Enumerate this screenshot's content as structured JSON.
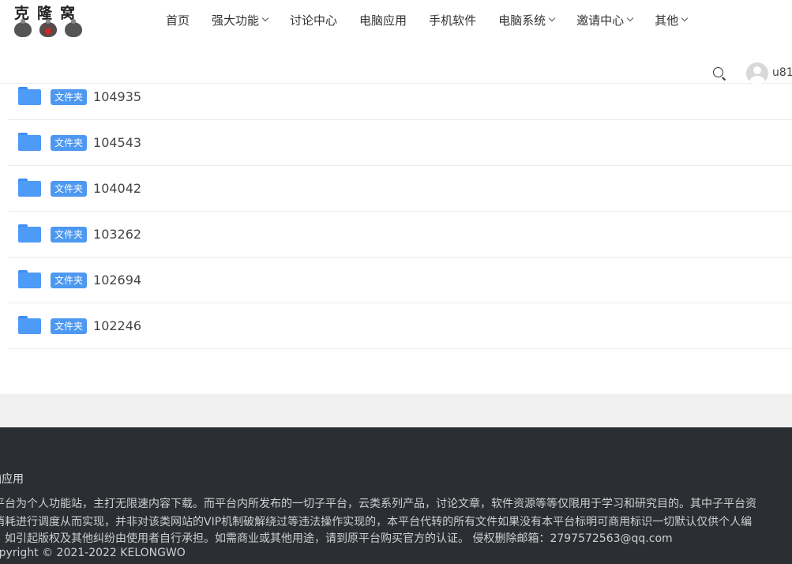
{
  "header": {
    "logo_text": "克隆窝",
    "nav": [
      {
        "label": "首页",
        "has_dropdown": false
      },
      {
        "label": "强大功能",
        "has_dropdown": true
      },
      {
        "label": "讨论中心",
        "has_dropdown": false
      },
      {
        "label": "电脑应用",
        "has_dropdown": false
      },
      {
        "label": "手机软件",
        "has_dropdown": false
      },
      {
        "label": "电脑系统",
        "has_dropdown": true
      },
      {
        "label": "邀请中心",
        "has_dropdown": true
      },
      {
        "label": "其他",
        "has_dropdown": true
      }
    ],
    "username": "u81"
  },
  "files": [
    {
      "badge": "文件夹",
      "name": "104935"
    },
    {
      "badge": "文件夹",
      "name": "104543"
    },
    {
      "badge": "文件夹",
      "name": "104042"
    },
    {
      "badge": "文件夹",
      "name": "103262"
    },
    {
      "badge": "文件夹",
      "name": "102694"
    },
    {
      "badge": "文件夹",
      "name": "102246"
    }
  ],
  "footer": {
    "title": "脑应用",
    "lines": [
      "平台为个人功能站，主打无限速内容下载。而平台内所发布的一切子平台，云类系列产品，讨论文章，软件资源等等仅限用于学习和研究目的。其中子平台资",
      "消耗进行调度从而实现，并非对该类网站的VIP机制破解绕过等违法操作实现的，本平台代转的所有文件如果没有本平台标明可商用标识一切默认仅供个人编",
      "如引起版权及其他纠纷由使用者自行承担。如需商业或其他用途，请到原平台购买官方的认证。 侵权删除邮箱：2797572563@qq.com"
    ],
    "copyright": "opyright © 2021-2022 KELONGWO"
  },
  "colors": {
    "accent": "#4d98f0",
    "folder": "#4e9af7",
    "footer_bg": "#2b2e33",
    "band_bg": "#f0f0f0"
  },
  "icons": [
    "folder-icon",
    "search-icon",
    "chevron-down-icon",
    "avatar-icon"
  ]
}
